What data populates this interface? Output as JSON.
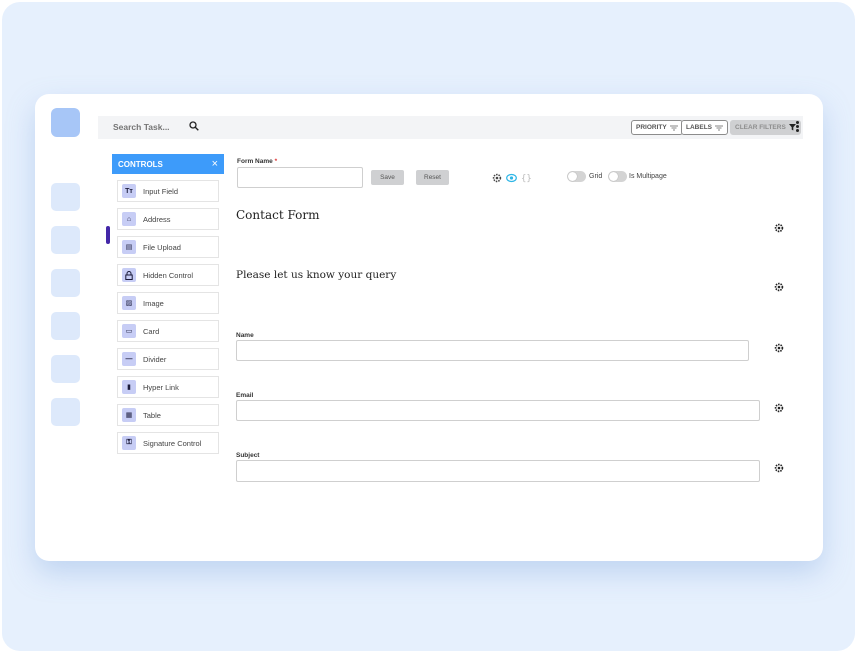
{
  "topbar": {
    "search_placeholder": "Search Task...",
    "priority_label": "PRIORITY",
    "labels_label": "LABELS",
    "clear_filters_label": "CLEAR FILTERS"
  },
  "controls": {
    "title": "CONTROLS",
    "close_glyph": "×",
    "items": [
      {
        "label": "Input Field",
        "icon": "text-icon",
        "glyph": "Tт"
      },
      {
        "label": "Address",
        "icon": "home-icon",
        "glyph": "⌂"
      },
      {
        "label": "File Upload",
        "icon": "file-icon",
        "glyph": "▤"
      },
      {
        "label": "Hidden Control",
        "icon": "lock-icon",
        "glyph": "🔒"
      },
      {
        "label": "Image",
        "icon": "image-icon",
        "glyph": "▨"
      },
      {
        "label": "Card",
        "icon": "card-icon",
        "glyph": "▭"
      },
      {
        "label": "Divider",
        "icon": "divider-icon",
        "glyph": "—"
      },
      {
        "label": "Hyper Link",
        "icon": "bookmark-icon",
        "glyph": "▮"
      },
      {
        "label": "Table",
        "icon": "table-icon",
        "glyph": "▦"
      },
      {
        "label": "Signature Control",
        "icon": "key-icon",
        "glyph": "⚿"
      }
    ]
  },
  "form_header": {
    "form_name_label": "Form Name",
    "required_mark": "*",
    "form_name_value": "",
    "save_label": "Save",
    "reset_label": "Reset",
    "grid_label": "Grid",
    "multipage_label": "Is Multipage"
  },
  "form": {
    "title": "Contact Form",
    "subtitle": "Please let us know your query",
    "fields": [
      {
        "label": "Name",
        "value": ""
      },
      {
        "label": "Email",
        "value": ""
      },
      {
        "label": "Subject",
        "value": ""
      }
    ]
  },
  "colors": {
    "accent": "#3d9bfa",
    "rail_active": "#4327a8",
    "eye_icon": "#2fb6e6"
  }
}
